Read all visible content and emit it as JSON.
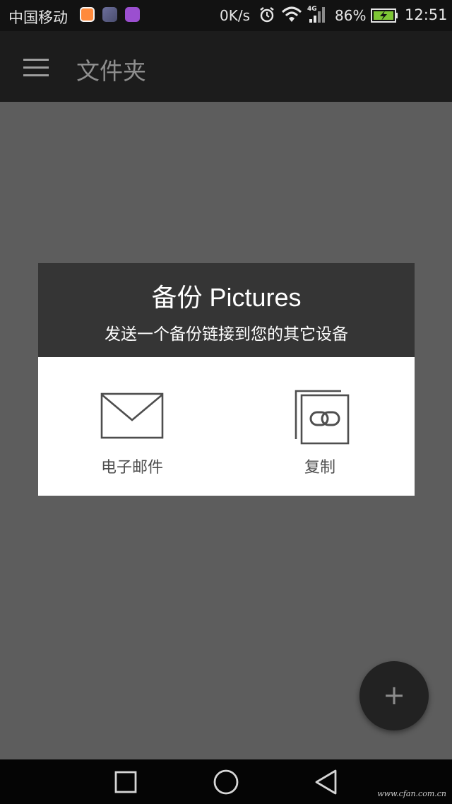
{
  "status_bar": {
    "carrier": "中国移动",
    "net_speed": "0K/s",
    "network_type": "4G",
    "battery": "86%",
    "time": "12:51",
    "icons": [
      "app-notification-icon",
      "app-notification-icon",
      "gallery-notification-icon",
      "alarm-icon",
      "wifi-icon",
      "signal-icon",
      "battery-charging-icon"
    ]
  },
  "app_bar": {
    "title": "文件夹",
    "menu_icon": "menu-icon"
  },
  "dialog": {
    "title": "备份 Pictures",
    "subtitle": "发送一个备份链接到您的其它设备",
    "options": [
      {
        "label": "电子邮件",
        "icon": "envelope-icon"
      },
      {
        "label": "复制",
        "icon": "copy-link-icon"
      }
    ]
  },
  "fab": {
    "label": "+",
    "icon": "plus-icon"
  },
  "nav_bar": {
    "buttons": [
      "recent-apps-icon",
      "home-icon",
      "back-icon"
    ],
    "watermark": "www.cfan.com.cn"
  },
  "colors": {
    "overlay": "#5d5d5d",
    "app_bar": "#1c1c1c",
    "status_bar": "#121212",
    "dialog_header": "#353535",
    "dialog_body": "#ffffff",
    "fab": "#222222"
  }
}
